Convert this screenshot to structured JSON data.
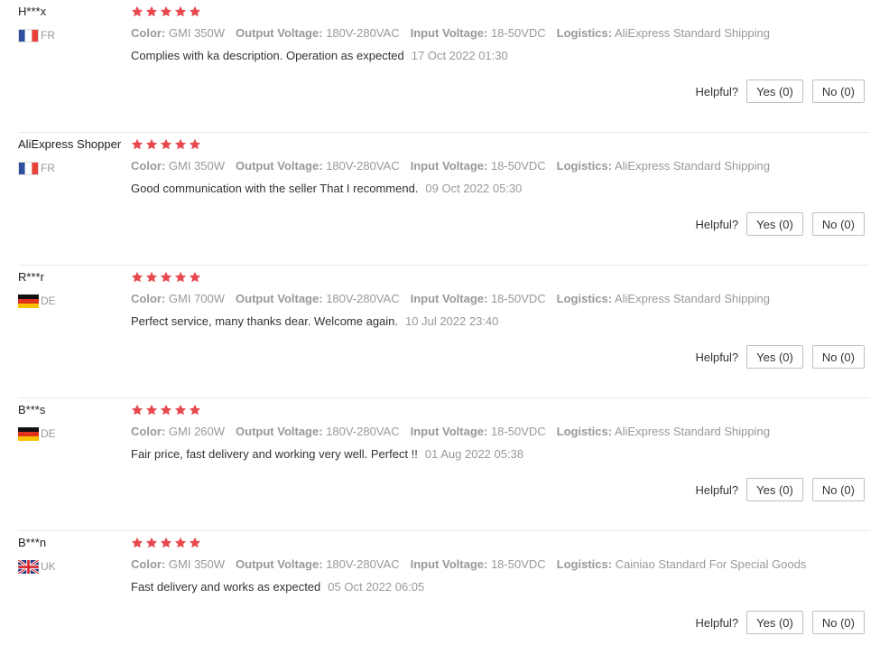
{
  "colors": {
    "star": "#e8494f",
    "muted_text": "#999999",
    "body_text": "#333333",
    "divider": "#e8e8e8"
  },
  "labels": {
    "color": "Color:",
    "output_voltage": "Output Voltage:",
    "input_voltage": "Input Voltage:",
    "logistics": "Logistics:",
    "helpful": "Helpful?"
  },
  "reviews": [
    {
      "user": "H***x",
      "country_code": "FR",
      "flag_icon": "france-flag-icon",
      "rating": 5,
      "color": "GMI 350W",
      "output_voltage": "180V-280VAC",
      "input_voltage": "18-50VDC",
      "logistics": "AliExpress Standard Shipping",
      "text": "Complies with ka description. Operation as expected",
      "time": "17 Oct 2022 01:30",
      "yes_label": "Yes (0)",
      "no_label": "No (0)"
    },
    {
      "user": "AliExpress Shopper",
      "country_code": "FR",
      "flag_icon": "france-flag-icon",
      "rating": 5,
      "color": "GMI 350W",
      "output_voltage": "180V-280VAC",
      "input_voltage": "18-50VDC",
      "logistics": "AliExpress Standard Shipping",
      "text": "Good communication with the seller That I recommend.",
      "time": "09 Oct 2022 05:30",
      "yes_label": "Yes (0)",
      "no_label": "No (0)"
    },
    {
      "user": "R***r",
      "country_code": "DE",
      "flag_icon": "germany-flag-icon",
      "rating": 5,
      "color": "GMI 700W",
      "output_voltage": "180V-280VAC",
      "input_voltage": "18-50VDC",
      "logistics": "AliExpress Standard Shipping",
      "text": "Perfect service, many thanks dear. Welcome again.",
      "time": "10 Jul 2022 23:40",
      "yes_label": "Yes (0)",
      "no_label": "No (0)"
    },
    {
      "user": "B***s",
      "country_code": "DE",
      "flag_icon": "germany-flag-icon",
      "rating": 5,
      "color": "GMI 260W",
      "output_voltage": "180V-280VAC",
      "input_voltage": "18-50VDC",
      "logistics": "AliExpress Standard Shipping",
      "text": "Fair price, fast delivery and working very well. Perfect !!",
      "time": "01 Aug 2022 05:38",
      "yes_label": "Yes (0)",
      "no_label": "No (0)"
    },
    {
      "user": "B***n",
      "country_code": "UK",
      "flag_icon": "uk-flag-icon",
      "rating": 5,
      "color": "GMI 350W",
      "output_voltage": "180V-280VAC",
      "input_voltage": "18-50VDC",
      "logistics": "Cainiao Standard For Special Goods",
      "text": "Fast delivery and works as expected",
      "time": "05 Oct 2022 06:05",
      "yes_label": "Yes (0)",
      "no_label": "No (0)"
    }
  ]
}
